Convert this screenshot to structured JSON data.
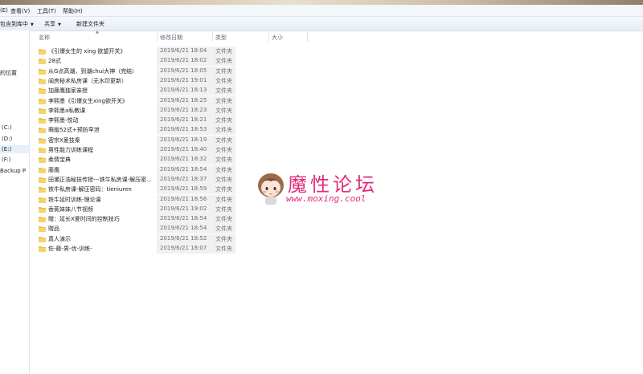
{
  "menubar": {
    "items": [
      "(E)",
      "查看(V)",
      "工具(T)",
      "帮助(H)"
    ]
  },
  "toolbar": {
    "include_library": "包含到库中",
    "share": "共享",
    "new_folder": "新建文件夹"
  },
  "nav": {
    "items": [
      "的位置",
      "(C:)",
      "(D:)",
      "(E:)",
      "(F:)",
      "Backup P"
    ]
  },
  "columns": {
    "name": "名称",
    "date": "修改日期",
    "type": "类型",
    "size": "大小"
  },
  "files": [
    {
      "name": "《引爆女生的 xing 欲望开关》",
      "date": "2019/6/21 18:04",
      "type": "文件夹"
    },
    {
      "name": "28式",
      "date": "2019/6/21 18:02",
      "type": "文件夹"
    },
    {
      "name": "从G点高潮，到潮chui大神（完结）",
      "date": "2019/6/21 18:05",
      "type": "文件夹"
    },
    {
      "name": "闺房秘术私房课（无水印更新）",
      "date": "2019/6/21 19:01",
      "type": "文件夹"
    },
    {
      "name": "加藤鹰独家亲授",
      "date": "2019/6/21 18:13",
      "type": "文件夹"
    },
    {
      "name": "李熙墨《引爆女生xing欲开关》",
      "date": "2019/6/21 18:25",
      "type": "文件夹"
    },
    {
      "name": "李熙墨a私教课",
      "date": "2019/6/21 18:23",
      "type": "文件夹"
    },
    {
      "name": "李熙墨-悦动",
      "date": "2019/6/21 18:21",
      "type": "文件夹"
    },
    {
      "name": "萌版52式+预防早泄",
      "date": "2019/6/21 18:53",
      "type": "文件夹"
    },
    {
      "name": "密宗X爱技秦",
      "date": "2019/6/21 18:19",
      "type": "文件夹"
    },
    {
      "name": "男性能力训练课程",
      "date": "2019/6/21 18:40",
      "type": "文件夹"
    },
    {
      "name": "柔情宝典",
      "date": "2019/6/21 18:32",
      "type": "文件夹"
    },
    {
      "name": "藤鹰",
      "date": "2019/6/21 18:54",
      "type": "文件夹"
    },
    {
      "name": "田瀬正浩秘技传授---铁牛私房课-解压密...",
      "date": "2019/6/21 18:37",
      "type": "文件夹"
    },
    {
      "name": "铁牛私房课-解压密码：tieniuren",
      "date": "2019/6/21 18:59",
      "type": "文件夹"
    },
    {
      "name": "铁牛延时训练-理论课",
      "date": "2019/6/21 18:56",
      "type": "文件夹"
    },
    {
      "name": "香蕉妹妹八节视频",
      "date": "2019/6/21 19:02",
      "type": "文件夹"
    },
    {
      "name": "赠：延长X爱时间的控制技巧",
      "date": "2019/6/21 18:54",
      "type": "文件夹"
    },
    {
      "name": "赠品",
      "date": "2019/6/21 18:54",
      "type": "文件夹"
    },
    {
      "name": "真人演示",
      "date": "2019/6/21 18:52",
      "type": "文件夹"
    },
    {
      "name": "佐-藤-男-优-训练-",
      "date": "2019/6/21 18:07",
      "type": "文件夹"
    }
  ],
  "watermark": {
    "title": "魔性论坛",
    "url": "www.moxing.cool"
  },
  "colors": {
    "folder": "#e8c04a",
    "watermark": "#e02c79",
    "selection": "#e5f0fb"
  }
}
